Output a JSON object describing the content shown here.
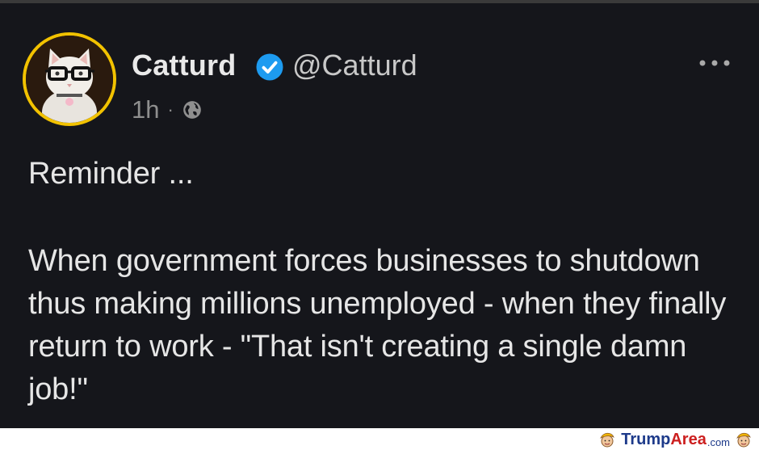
{
  "post": {
    "author_name": "Catturd",
    "handle": "@Catturd",
    "time": "1h",
    "separator": "·",
    "verified": true,
    "paragraphs": [
      "Reminder ...",
      "When government forces businesses to shutdown thus making millions unemployed - when they finally return to work - \"That isn't creating a single damn job!\""
    ]
  },
  "icons": {
    "verified": "verified-badge-icon",
    "visibility": "globe-icon",
    "menu": "more-options-icon",
    "avatar": "cat-with-glasses-avatar",
    "brand": "trump-face-logo-icon"
  },
  "colors": {
    "background": "#15161b",
    "avatar_ring": "#f2c200",
    "verified_badge": "#1d9bf0",
    "text_primary": "#e6e6e6",
    "text_secondary": "#8f8f8f"
  },
  "watermark": {
    "part1": "Trump",
    "part2": "Area",
    "part3": ".com"
  }
}
